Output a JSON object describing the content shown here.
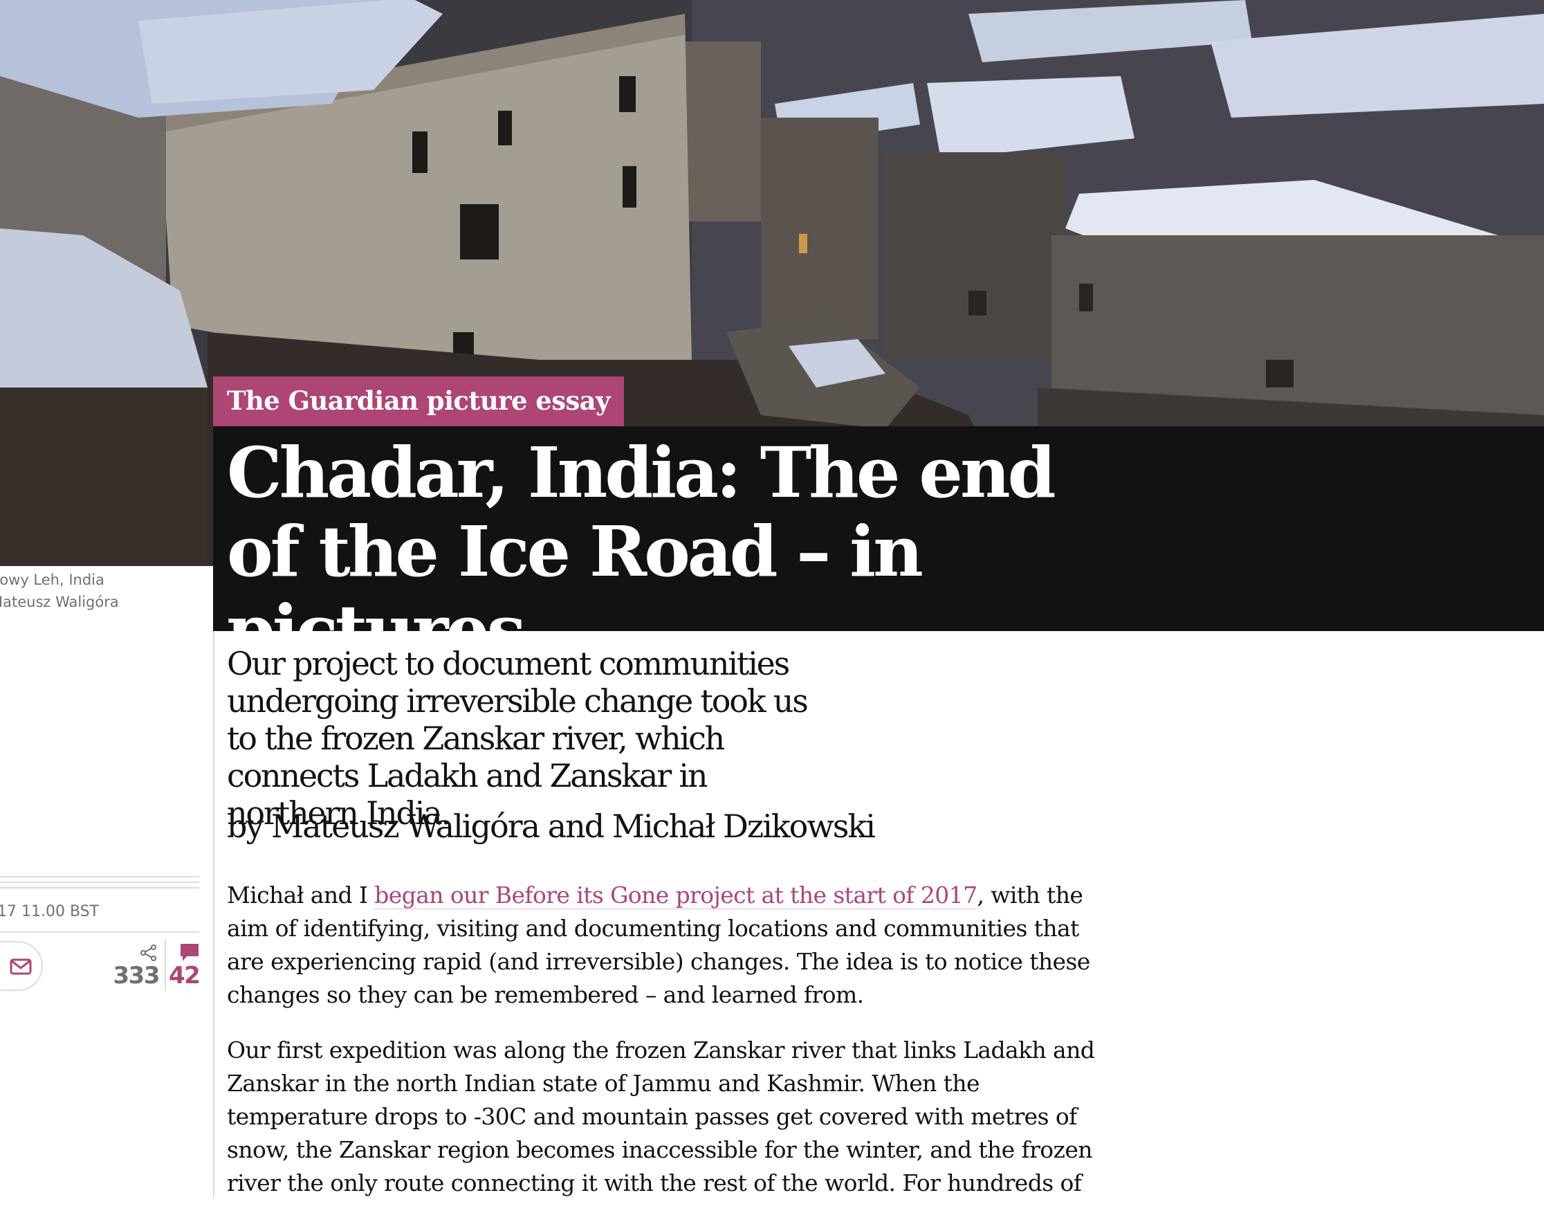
{
  "hero": {
    "caption_line_1": "nowy Leh, India",
    "caption_line_2": "Mateusz Waligóra"
  },
  "article": {
    "kicker": "The Guardian picture essay",
    "headline": "Chadar, India: The end of the Ice Road – in pictures",
    "standfirst": "Our project to document communities undergoing irreversible change took us to the frozen Zanskar river, which connects Ladakh and Zanskar in northern India.",
    "byline": "by Mateusz Waligóra and Michał Dzikowski"
  },
  "meta": {
    "dateline": "17 11.00 BST",
    "share_count": "333",
    "comment_count": "42"
  },
  "body": {
    "p1_before_link": "Michał and I ",
    "p1_link": "began our Before its Gone project at the start of 2017",
    "p1_after_link": ", with the aim of identifying, visiting and documenting locations and communities that are experiencing rapid (and irreversible) changes. The idea is to notice these changes so they can be remembered – and learned from.",
    "p2": "Our first expedition was along the frozen Zanskar river that links Ladakh and Zanskar in the north Indian state of Jammu and Kashmir. When the temperature drops to -30C and mountain passes get covered with metres of snow, the Zanskar region becomes inaccessible for the winter, and the frozen river the only route connecting it with the rest of the world. For hundreds of"
  },
  "colors": {
    "accent": "#ad4575",
    "headline_bg": "#121212",
    "meta_text": "#707070"
  },
  "icons": [
    "email-icon",
    "share-icon",
    "comment-icon"
  ]
}
